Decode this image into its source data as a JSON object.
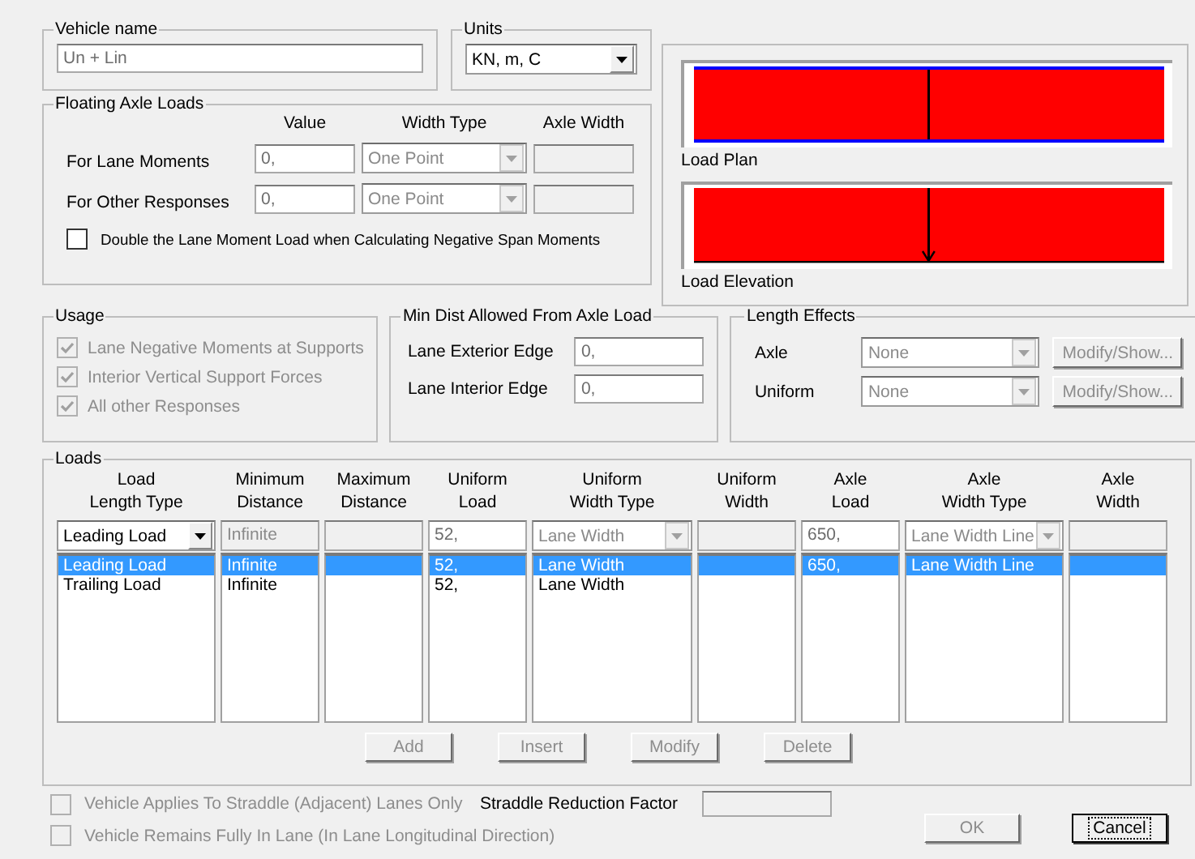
{
  "vehicle_name": {
    "title": "Vehicle name",
    "value": "Un + Lin"
  },
  "units": {
    "title": "Units",
    "value": "KN, m, C"
  },
  "floating_axle_loads": {
    "title": "Floating Axle Loads",
    "columns": [
      "Value",
      "Width Type",
      "Axle Width"
    ],
    "rows": [
      {
        "label": "For Lane Moments",
        "value": "0,",
        "width_type": "One Point"
      },
      {
        "label": "For Other Responses",
        "value": "0,",
        "width_type": "One Point"
      }
    ],
    "double_load": {
      "label": "Double the Lane Moment Load when Calculating Negative Span Moments",
      "checked": false
    }
  },
  "load_plan": {
    "label": "Load Plan"
  },
  "load_elevation": {
    "label": "Load Elevation"
  },
  "usage": {
    "title": "Usage",
    "items": [
      {
        "label": "Lane Negative Moments at Supports",
        "checked": true,
        "disabled": true
      },
      {
        "label": "Interior Vertical Support Forces",
        "checked": true,
        "disabled": true
      },
      {
        "label": "All other Responses",
        "checked": true,
        "disabled": true
      }
    ]
  },
  "min_dist": {
    "title": "Min Dist Allowed From Axle Load",
    "rows": [
      {
        "label": "Lane Exterior Edge",
        "value": "0,"
      },
      {
        "label": "Lane Interior Edge",
        "value": "0,"
      }
    ]
  },
  "length_effects": {
    "title": "Length Effects",
    "rows": [
      {
        "label": "Axle",
        "value": "None",
        "button": "Modify/Show...",
        "disabled": true
      },
      {
        "label": "Uniform",
        "value": "None",
        "button": "Modify/Show...",
        "disabled": true
      }
    ]
  },
  "loads": {
    "title": "Loads",
    "columns": [
      "Load\nLength Type",
      "Minimum\nDistance",
      "Maximum\nDistance",
      "Uniform\nLoad",
      "Uniform\nWidth Type",
      "Uniform\nWidth",
      "Axle\nLoad",
      "Axle\nWidth Type",
      "Axle\nWidth"
    ],
    "edit_row": [
      {
        "kind": "dropdown",
        "value": "Leading Load",
        "disabled": false
      },
      {
        "kind": "text",
        "value": "Infinite",
        "disabled": true
      },
      {
        "kind": "text",
        "disabled": true
      },
      {
        "kind": "text",
        "value": "52,",
        "disabled": false
      },
      {
        "kind": "dropdown",
        "value": "Lane Width",
        "disabled": true
      },
      {
        "kind": "text",
        "disabled": true
      },
      {
        "kind": "text",
        "value": "650,",
        "disabled": false
      },
      {
        "kind": "dropdown",
        "value": "Lane Width Line",
        "disabled": true
      },
      {
        "kind": "text",
        "disabled": true
      }
    ],
    "rows": [
      {
        "length_type": "Leading Load",
        "min_distance": "Infinite",
        "uniform_load": "52,",
        "uniform_width_type": "Lane Width",
        "axle_load": "650,",
        "axle_width_type": "Lane Width Line",
        "selected": true
      },
      {
        "length_type": "Trailing Load",
        "min_distance": "Infinite",
        "uniform_load": "52,",
        "uniform_width_type": "Lane Width",
        "selected": false
      }
    ],
    "buttons": [
      {
        "label": "Add",
        "disabled": true
      },
      {
        "label": "Insert",
        "disabled": true
      },
      {
        "label": "Modify",
        "disabled": true
      },
      {
        "label": "Delete",
        "disabled": true
      }
    ]
  },
  "straddle": {
    "label": "Vehicle Applies To Straddle (Adjacent) Lanes Only",
    "checked": false,
    "disabled": true
  },
  "straddle_factor": {
    "label": "Straddle Reduction Factor"
  },
  "in_lane": {
    "label": "Vehicle Remains Fully In Lane (In Lane Longitudinal Direction)",
    "checked": false,
    "disabled": true
  },
  "buttons": [
    {
      "label": "OK",
      "disabled": true,
      "default": false
    },
    {
      "label": "Cancel",
      "disabled": false,
      "default": true
    }
  ]
}
